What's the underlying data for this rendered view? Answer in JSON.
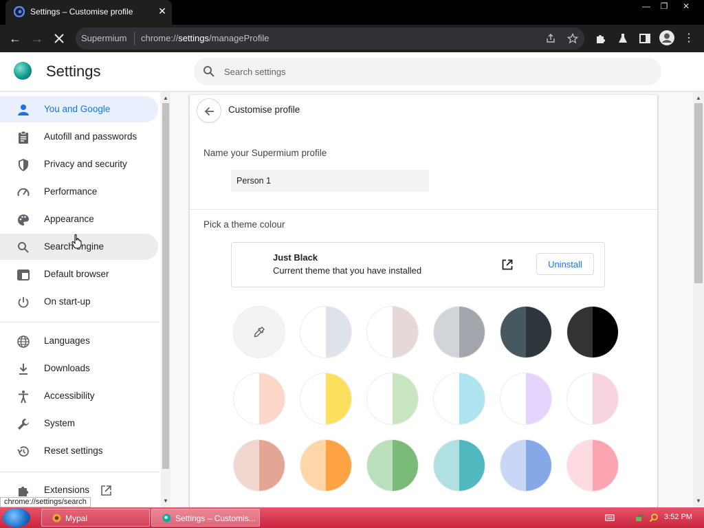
{
  "browser": {
    "tab_title": "Settings – Customise profile",
    "tab_close": "✕",
    "window_controls": {
      "minimize": "—",
      "restore": "❐",
      "close": "✕"
    },
    "omnibox": {
      "site": "Supermium",
      "url_prefix": "chrome://",
      "url_host": "settings",
      "url_path": "/manageProfile"
    }
  },
  "header": {
    "title": "Settings",
    "search_placeholder": "Search settings"
  },
  "sidebar": {
    "items": [
      {
        "label": "You and Google",
        "icon": "person-icon"
      },
      {
        "label": "Autofill and passwords",
        "icon": "clipboard-icon"
      },
      {
        "label": "Privacy and security",
        "icon": "shield-icon"
      },
      {
        "label": "Performance",
        "icon": "speedometer-icon"
      },
      {
        "label": "Appearance",
        "icon": "palette-icon"
      },
      {
        "label": "Search engine",
        "icon": "search-icon"
      },
      {
        "label": "Default browser",
        "icon": "browser-window-icon"
      },
      {
        "label": "On start-up",
        "icon": "power-icon"
      },
      {
        "label": "Languages",
        "icon": "globe-icon"
      },
      {
        "label": "Downloads",
        "icon": "download-icon"
      },
      {
        "label": "Accessibility",
        "icon": "accessibility-icon"
      },
      {
        "label": "System",
        "icon": "wrench-icon"
      },
      {
        "label": "Reset settings",
        "icon": "history-icon"
      },
      {
        "label": "Extensions",
        "icon": "puzzle-icon"
      }
    ],
    "active_index": 0,
    "hover_index": 5
  },
  "main": {
    "page_title": "Customise profile",
    "name_label": "Name your Supermium profile",
    "name_value": "Person 1",
    "theme_label": "Pick a theme colour",
    "theme": {
      "name": "Just Black",
      "description": "Current theme that you have installed",
      "uninstall_label": "Uninstall"
    },
    "swatches": [
      [
        "custom",
        "#f1f3f4",
        "#f1f3f4"
      ],
      [
        "white-grey",
        "#ffffff",
        "#dee3ea"
      ],
      [
        "white-beige",
        "#ffffff",
        "#e6d8d6"
      ],
      [
        "grey",
        "#d1d4d9",
        "#a3a6ad"
      ],
      [
        "slate",
        "#475861",
        "#2c363b"
      ],
      [
        "black",
        "#333333",
        "#000000"
      ],
      [
        "peach",
        "#ffffff",
        "#fcd6c6"
      ],
      [
        "yellow",
        "#ffffff",
        "#fddf5e"
      ],
      [
        "mint",
        "#ffffff",
        "#c8e7c1"
      ],
      [
        "aqua",
        "#ffffff",
        "#ade4ef"
      ],
      [
        "lavender",
        "#ffffff",
        "#e5d4fb"
      ],
      [
        "pink",
        "#ffffff",
        "#f8d3e1"
      ],
      [
        "rose",
        "#f1d6cf",
        "#e3a594"
      ],
      [
        "orange",
        "#fed6a8",
        "#fea343"
      ],
      [
        "green",
        "#bbdebb",
        "#78ba76"
      ],
      [
        "teal",
        "#b1e0e0",
        "#52b8bf"
      ],
      [
        "blue",
        "#c8d7f3",
        "#86a8e6"
      ],
      [
        "light-pink",
        "#fddbe0",
        "#fca4b1"
      ]
    ]
  },
  "status_bar": "chrome://settings/search",
  "taskbar": {
    "tasks": [
      {
        "label": "Mypal"
      },
      {
        "label": "Settings – Customis..."
      }
    ],
    "clock": "3:52 PM"
  }
}
